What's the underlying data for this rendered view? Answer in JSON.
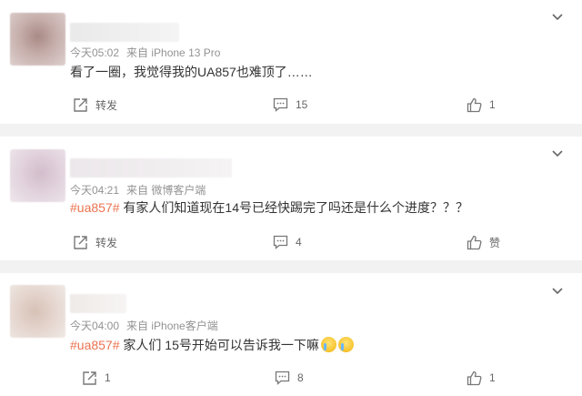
{
  "comments": [
    {
      "time": "今天05:02",
      "source": "来自 iPhone 13 Pro",
      "hashtag": "",
      "text": "看了一圈，我觉得我的UA857也难顶了……",
      "forward_label": "转发",
      "comment_count": "15",
      "like_label": "1"
    },
    {
      "time": "今天04:21",
      "source": "来自 微博客户端",
      "hashtag": "#ua857#",
      "text": " 有家人们知道现在14号已经快踢完了吗还是什么个进度？？？",
      "forward_label": "转发",
      "comment_count": "4",
      "like_label": "赞"
    },
    {
      "time": "今天04:00",
      "source": "来自 iPhone客户端",
      "hashtag": "#ua857#",
      "text": " 家人们 15号开始可以告诉我一下嘛",
      "emoji": [
        "crying-face-emoji",
        "crying-face-emoji"
      ],
      "forward_label": "1",
      "comment_count": "8",
      "like_label": "1"
    }
  ],
  "colors": {
    "hashtag": "#eb7350",
    "meta": "#939393",
    "background": "#f2f2f2"
  },
  "icons": {
    "forward": "share-icon",
    "comment": "comment-icon",
    "like": "thumbs-up-icon",
    "more": "chevron-down-icon"
  }
}
